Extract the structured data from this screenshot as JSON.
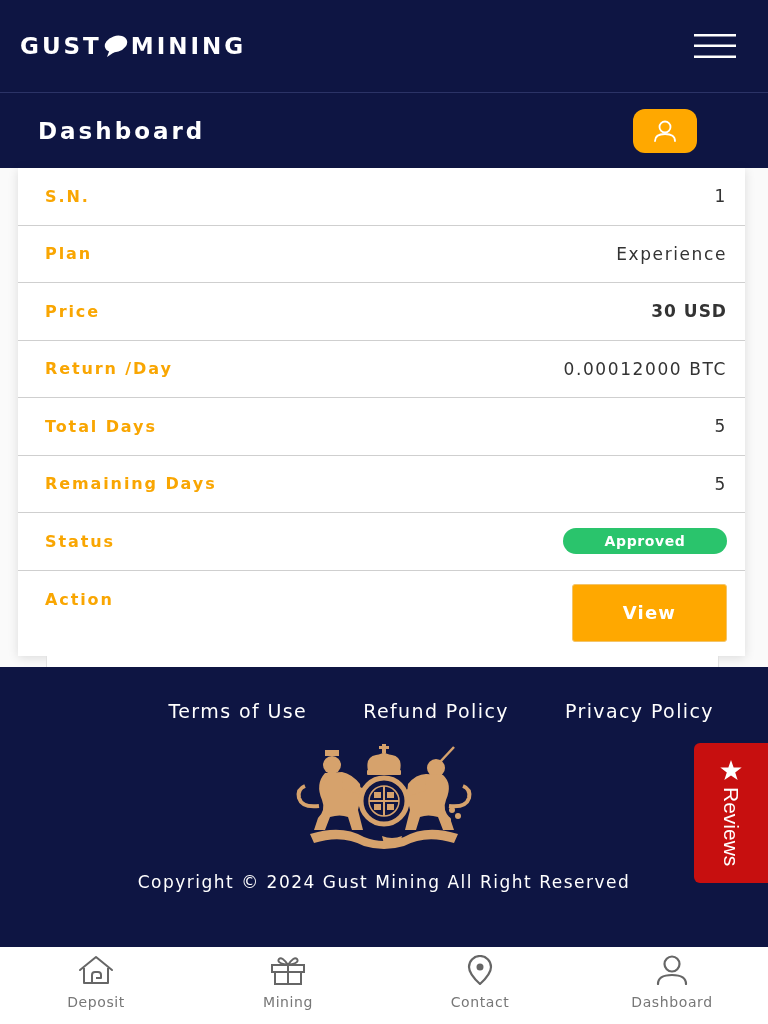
{
  "header": {
    "logo": {
      "before_mark": "GUST",
      "after_mark": "MINING"
    }
  },
  "title_bar": {
    "title": "Dashboard"
  },
  "plan_details": [
    {
      "kind": "text",
      "label": "S.N.",
      "value": "1"
    },
    {
      "kind": "text",
      "label": "Plan",
      "value": "Experience"
    },
    {
      "kind": "strong",
      "label": "Price",
      "value": "30 USD"
    },
    {
      "kind": "text",
      "label": "Return /Day",
      "value": "0.00012000 BTC"
    },
    {
      "kind": "text",
      "label": "Total Days",
      "value": "5"
    },
    {
      "kind": "text",
      "label": "Remaining Days",
      "value": "5"
    },
    {
      "kind": "badge",
      "label": "Status",
      "value": "Approved"
    },
    {
      "kind": "button",
      "label": "Action",
      "value": "View"
    }
  ],
  "footer": {
    "links": [
      "Terms of Use",
      "Refund Policy",
      "Privacy Policy"
    ],
    "copyright": "Copyright © 2024 Gust Mining All Right Reserved"
  },
  "reviews_tab": {
    "label": "Reviews"
  },
  "bottom_nav": [
    {
      "label": "Deposit"
    },
    {
      "label": "Mining"
    },
    {
      "label": "Contact"
    },
    {
      "label": "Dashboard"
    }
  ]
}
